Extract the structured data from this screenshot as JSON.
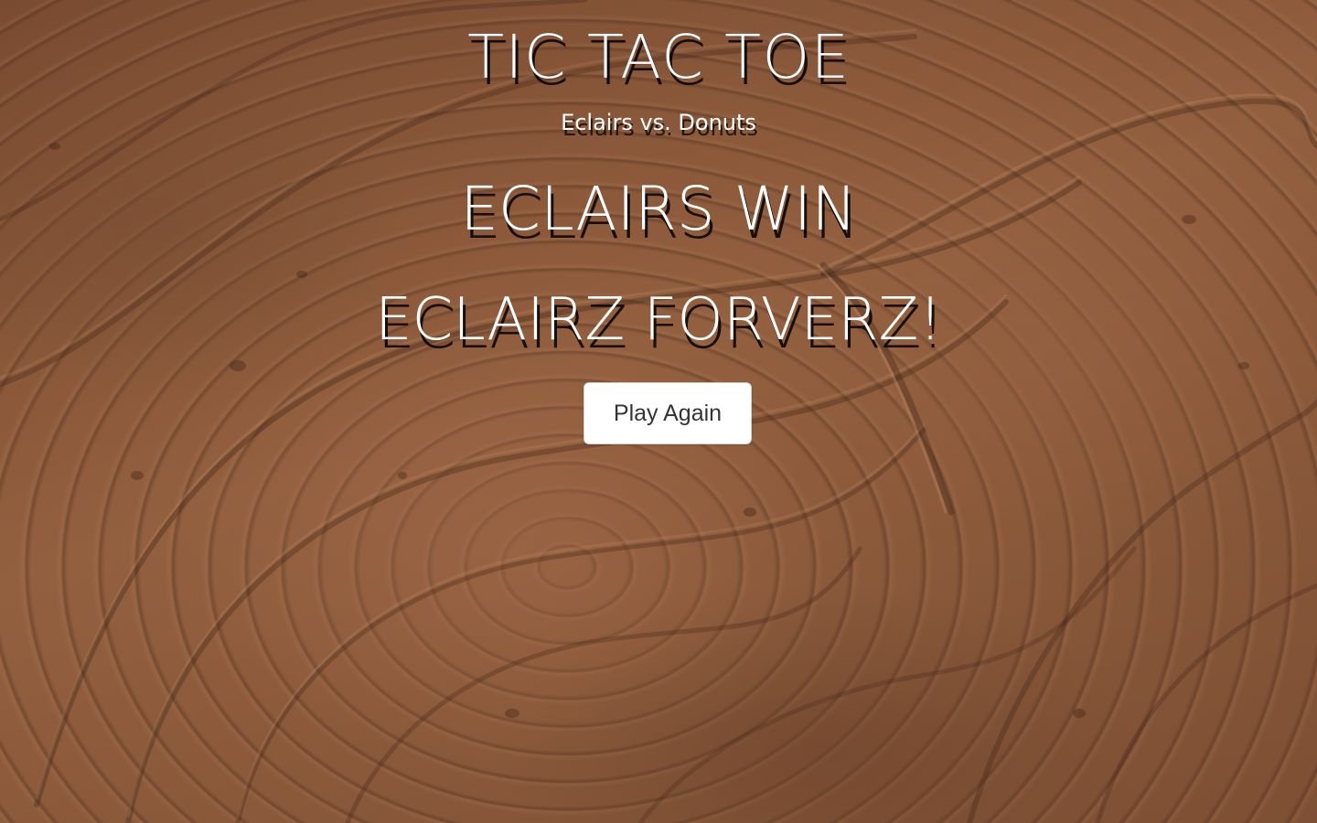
{
  "header": {
    "title": "TIC TAC TOE",
    "subtitle": "Eclairs vs. Donuts"
  },
  "game_over": {
    "result": "ECLAIRS WIN",
    "message": "ECLAIRZ FORVERZ!",
    "play_again_label": "Play Again"
  },
  "background": {
    "description_color": "#8a5a3c"
  }
}
